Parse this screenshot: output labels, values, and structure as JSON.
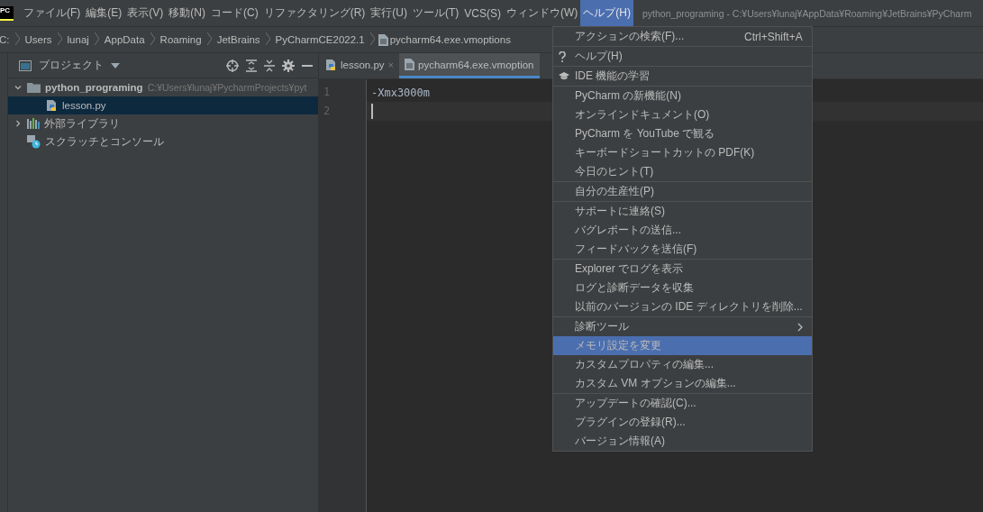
{
  "menu_bar": {
    "logo": "PC",
    "items": [
      {
        "label": "ファイル(F)",
        "selected": false
      },
      {
        "label": "編集(E)",
        "selected": false
      },
      {
        "label": "表示(V)",
        "selected": false
      },
      {
        "label": "移動(N)",
        "selected": false
      },
      {
        "label": "コード(C)",
        "selected": false
      },
      {
        "label": "リファクタリング(R)",
        "selected": false
      },
      {
        "label": "実行(U)",
        "selected": false
      },
      {
        "label": "ツール(T)",
        "selected": false
      },
      {
        "label": "VCS(S)",
        "selected": false
      },
      {
        "label": "ウィンドウ(W)",
        "selected": false
      },
      {
        "label": "ヘルプ(H)",
        "selected": true
      }
    ],
    "window_title": "python_programing - C:¥Users¥lunaj¥AppData¥Roaming¥JetBrains¥PyCharm"
  },
  "breadcrumbs": [
    "C:",
    "Users",
    "lunaj",
    "AppData",
    "Roaming",
    "JetBrains",
    "PyCharmCE2022.1",
    "pycharm64.exe.vmoptions"
  ],
  "project_panel": {
    "title": "プロジェクト",
    "tree": [
      {
        "label": "python_programing",
        "path": "C:¥Users¥lunaj¥PycharmProjects¥pyt",
        "kind": "folder",
        "expanded": true,
        "selected": false,
        "children": [
          {
            "label": "lesson.py",
            "kind": "python",
            "selected": true
          }
        ]
      },
      {
        "label": "外部ライブラリ",
        "kind": "library",
        "expanded": false,
        "selected": false
      },
      {
        "label": "スクラッチとコンソール",
        "kind": "scratch",
        "selected": false
      }
    ]
  },
  "editor": {
    "tabs": [
      {
        "label": "lesson.py",
        "kind": "python",
        "close": "×",
        "selected": false
      },
      {
        "label": "pycharm64.exe.vmoption",
        "kind": "file",
        "selected": true
      }
    ],
    "lines": [
      {
        "number": "1",
        "text": "-Xmx3000m",
        "current": false
      },
      {
        "number": "2",
        "current": true
      }
    ]
  },
  "help_menu": {
    "groups": [
      [
        {
          "label": "アクションの検索(F)...",
          "shortcut": "Ctrl+Shift+A",
          "selected": false
        }
      ],
      [
        {
          "label": "ヘルプ(H)",
          "kind": "help",
          "selected": false
        }
      ],
      [
        {
          "label": "IDE 機能の学習",
          "kind": "learn",
          "selected": false
        }
      ],
      [
        {
          "label": "PyCharm の新機能(N)",
          "selected": false
        },
        {
          "label": "オンラインドキュメント(O)",
          "selected": false
        },
        {
          "label": "PyCharm を YouTube で観る",
          "selected": false
        },
        {
          "label": "キーボードショートカットの PDF(K)",
          "selected": false
        },
        {
          "label": "今日のヒント(T)",
          "selected": false
        }
      ],
      [
        {
          "label": "自分の生産性(P)",
          "selected": false
        }
      ],
      [
        {
          "label": "サポートに連絡(S)",
          "selected": false
        },
        {
          "label": "バグレポートの送信...",
          "selected": false
        },
        {
          "label": "フィードバックを送信(F)",
          "selected": false
        }
      ],
      [
        {
          "label": "Explorer でログを表示",
          "selected": false
        },
        {
          "label": "ログと診断データを収集",
          "selected": false
        },
        {
          "label": "以前のバージョンの IDE ディレクトリを削除...",
          "selected": false
        }
      ],
      [
        {
          "label": "診断ツール",
          "submenu": true,
          "selected": false
        },
        {
          "label": "メモリ設定を変更",
          "selected": true
        },
        {
          "label": "カスタムプロパティの編集...",
          "selected": false
        },
        {
          "label": "カスタム VM オプションの編集...",
          "selected": false
        }
      ],
      [
        {
          "label": "アップデートの確認(C)...",
          "selected": false
        },
        {
          "label": "プラグインの登録(R)...",
          "selected": false
        },
        {
          "label": "バージョン情報(A)",
          "selected": false
        }
      ]
    ]
  }
}
